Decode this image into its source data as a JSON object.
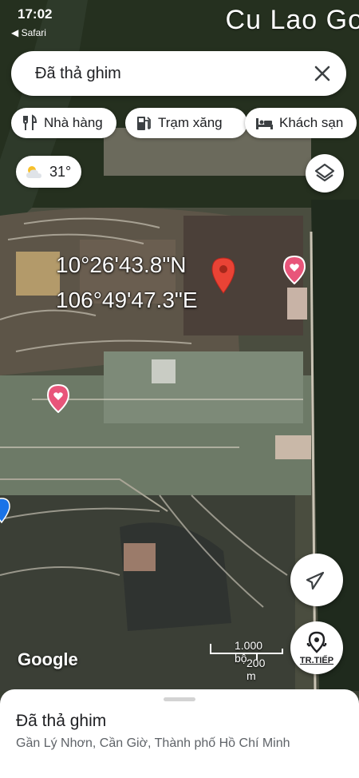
{
  "status_bar": {
    "time": "17:02",
    "back_label": "◀ Safari"
  },
  "map_overlay": {
    "place_label": "Cu Lao Go"
  },
  "search": {
    "text": "Đã thả ghim"
  },
  "chips": [
    {
      "label": "Nhà hàng",
      "icon": "restaurant-icon"
    },
    {
      "label": "Trạm xăng",
      "icon": "gas-station-icon"
    },
    {
      "label": "Khách sạn",
      "icon": "hotel-icon"
    }
  ],
  "weather": {
    "temperature": "31°",
    "icon": "partly-cloudy-icon"
  },
  "coordinates": {
    "lat": "10°26'43.8\"N",
    "lng": "106°49'47.3\"E"
  },
  "scale": {
    "imperial": "1.000 bộ",
    "metric": "200 m"
  },
  "attribution": "Google",
  "directions_label": "TR.TIẾP",
  "sheet": {
    "title": "Đã thả ghim",
    "address": "Gần Lý Nhơn, Cần Giờ, Thành phố Hồ Chí Minh"
  },
  "colors": {
    "pin": "#e94335",
    "heart": "#e8557a",
    "blue_pin": "#1a73e8"
  }
}
